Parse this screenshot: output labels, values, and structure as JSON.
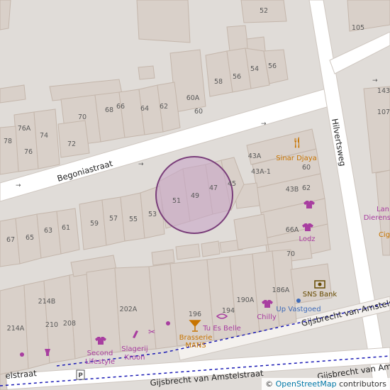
{
  "map": {
    "streets": {
      "begoniastraat": "Begoniastraat",
      "hilvertsweg": "Hilvertsweg",
      "gijsbrecht_upper": "Gijsbrecht van Amstelstraat",
      "gijsbrecht_lower": "Gijsbrecht van Amstelstraat",
      "gijsbrecht_stub": "Gijsbrecht van Amstelstraat",
      "amstelstraat_left": "elstraat"
    },
    "house_numbers": {
      "n52": "52",
      "n105": "105",
      "n54a": "54",
      "n56": "56",
      "n56b": "56",
      "n58": "58",
      "n60a": "60A",
      "n60": "60",
      "n68": "68",
      "n66": "66",
      "n64": "64",
      "n62": "62",
      "n70": "70",
      "n76a": "76A",
      "n74": "74",
      "n78": "78",
      "n76": "76",
      "n72": "72",
      "n43a": "43A",
      "n43a1": "43A-1",
      "n60b": "60",
      "n43b": "43B",
      "n62b": "62",
      "n66a": "66A",
      "n70b": "70",
      "n51": "51",
      "n49": "49",
      "n47": "47",
      "n45": "45",
      "n67": "67",
      "n65": "65",
      "n63": "63",
      "n61": "61",
      "n59": "59",
      "n57": "57",
      "n55": "55",
      "n53": "53",
      "n214b": "214B",
      "n214a": "214A",
      "n210": "210",
      "n208": "208",
      "n202a": "202A",
      "n196": "196",
      "n190a": "190A",
      "n186a": "186A",
      "n143": "143",
      "n107": "107",
      "n194": "194"
    },
    "pois": {
      "sinar_djaya": "Sinar Djaya",
      "lodz": "Lodz",
      "landieren_1": "Lan",
      "landieren_2": "Dierensp",
      "cig": "Cig",
      "sns_bank": "SNS Bank",
      "up_vastgoed": "Up Vastgoed",
      "chilly": "Chilly",
      "tu_es_belle": "Tu Es Belle",
      "brasserie": "Brasserie",
      "mans": "MANS",
      "slagerij": "Slagerij",
      "kroon": "Kroon",
      "second": "Second",
      "lifestyle": "Lifestyle"
    },
    "attribution": {
      "prefix": "© ",
      "link": "OpenStreetMap",
      "suffix": " contributors"
    },
    "colors": {
      "background": "#e0dcd8",
      "road": "#ffffff",
      "building": "#d9d0c9",
      "building_outline": "#c4b6ab",
      "highlight_fill": "#c8a6c8",
      "highlight_stroke": "#7a3e7a",
      "shop_purple": "#a83ea0",
      "food_orange": "#c77400",
      "tram_line": "#1b1bb5"
    }
  }
}
